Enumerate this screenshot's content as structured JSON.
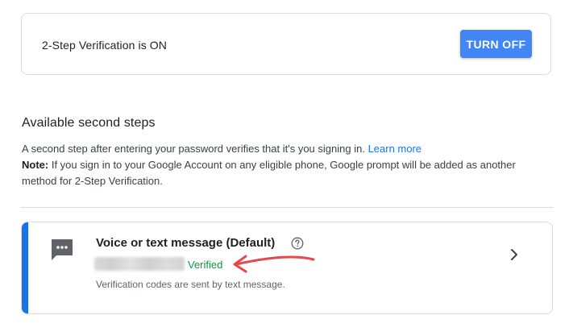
{
  "status_card": {
    "text": "2-Step Verification is ON",
    "button_label": "TURN OFF"
  },
  "available_steps": {
    "title": "Available second steps",
    "description": "A second step after entering your password verifies that it's you signing in.",
    "learn_more": "Learn more",
    "note_label": "Note:",
    "note_text": "If you sign in to your Google Account on any eligible phone, Google prompt will be added as another method for 2-Step Verification."
  },
  "method": {
    "title": "Voice or text message (Default)",
    "status": "Verified",
    "detail": "Verification codes are sent by text message.",
    "icon": "message-icon",
    "help_icon": "help-icon",
    "chevron_icon": "chevron-right-icon"
  },
  "colors": {
    "primary_button": "#4285f4",
    "accent": "#1a73e8",
    "verified": "#1e8e3e",
    "annotation": "#e5484d"
  }
}
